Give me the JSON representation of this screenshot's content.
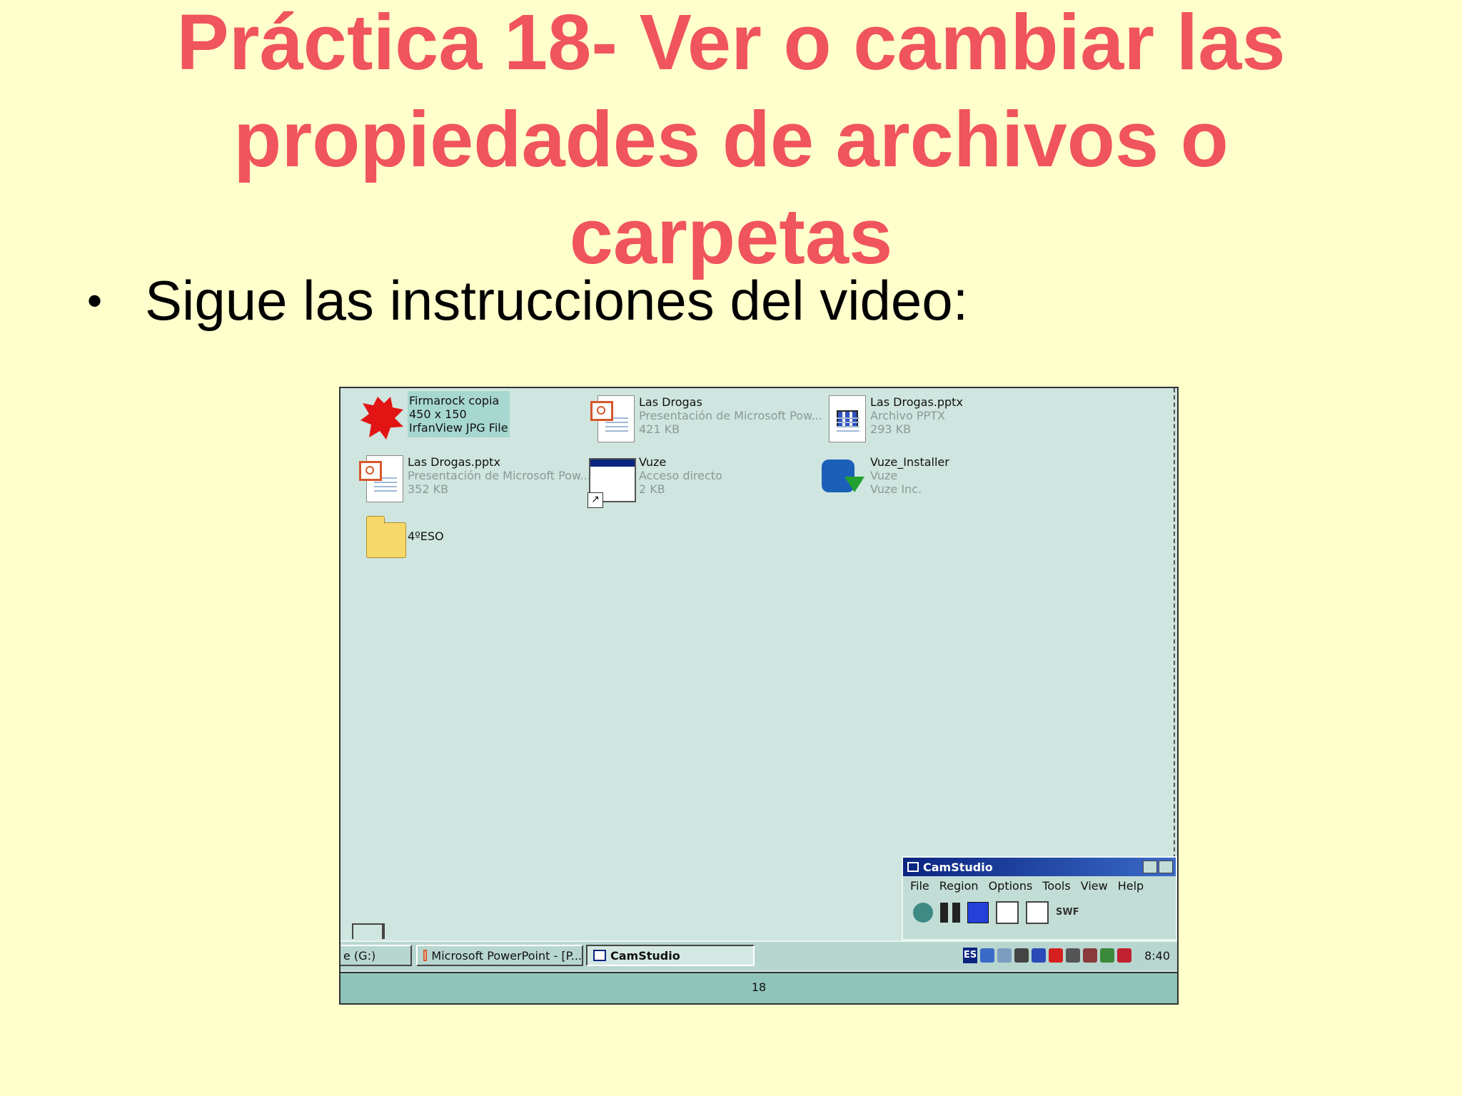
{
  "slide": {
    "title_lines": [
      "Práctica 18- Ver o cambiar las",
      "propiedades de archivos o",
      "carpetas"
    ],
    "bullet": "Sigue las instrucciones del video:"
  },
  "explorer": {
    "files": [
      {
        "name": "Firmarock copia",
        "line2": "450 x 150",
        "line3": "IrfanView JPG File",
        "icon": "jpg-image-icon",
        "selected": true
      },
      {
        "name": "Las Drogas",
        "line2": "Presentación de Microsoft Pow...",
        "line3": "421 KB",
        "icon": "powerpoint-icon"
      },
      {
        "name": "Las Drogas.pptx",
        "line2": "Archivo PPTX",
        "line3": "293 KB",
        "icon": "pptx-generic-icon"
      },
      {
        "name": "Las Drogas.pptx",
        "line2": "Presentación de Microsoft Pow...",
        "line3": "352 KB",
        "icon": "powerpoint-icon"
      },
      {
        "name": "Vuze",
        "line2": "Acceso directo",
        "line3": "2 KB",
        "icon": "shortcut-window-icon"
      },
      {
        "name": "Vuze_Installer",
        "line2": "Vuze",
        "line3": "Vuze Inc.",
        "icon": "vuze-icon"
      },
      {
        "name": "4ºESO",
        "line2": "",
        "line3": "",
        "icon": "folder-icon"
      }
    ]
  },
  "taskbar": {
    "items": [
      "e (G:)",
      "Microsoft PowerPoint - [P...",
      "CamStudio"
    ],
    "lang": "ES",
    "clock": "8:40"
  },
  "camstudio": {
    "title": "CamStudio",
    "menu": [
      "File",
      "Region",
      "Options",
      "Tools",
      "View",
      "Help"
    ],
    "swf_label": "SWF"
  },
  "status": {
    "page": "18"
  }
}
